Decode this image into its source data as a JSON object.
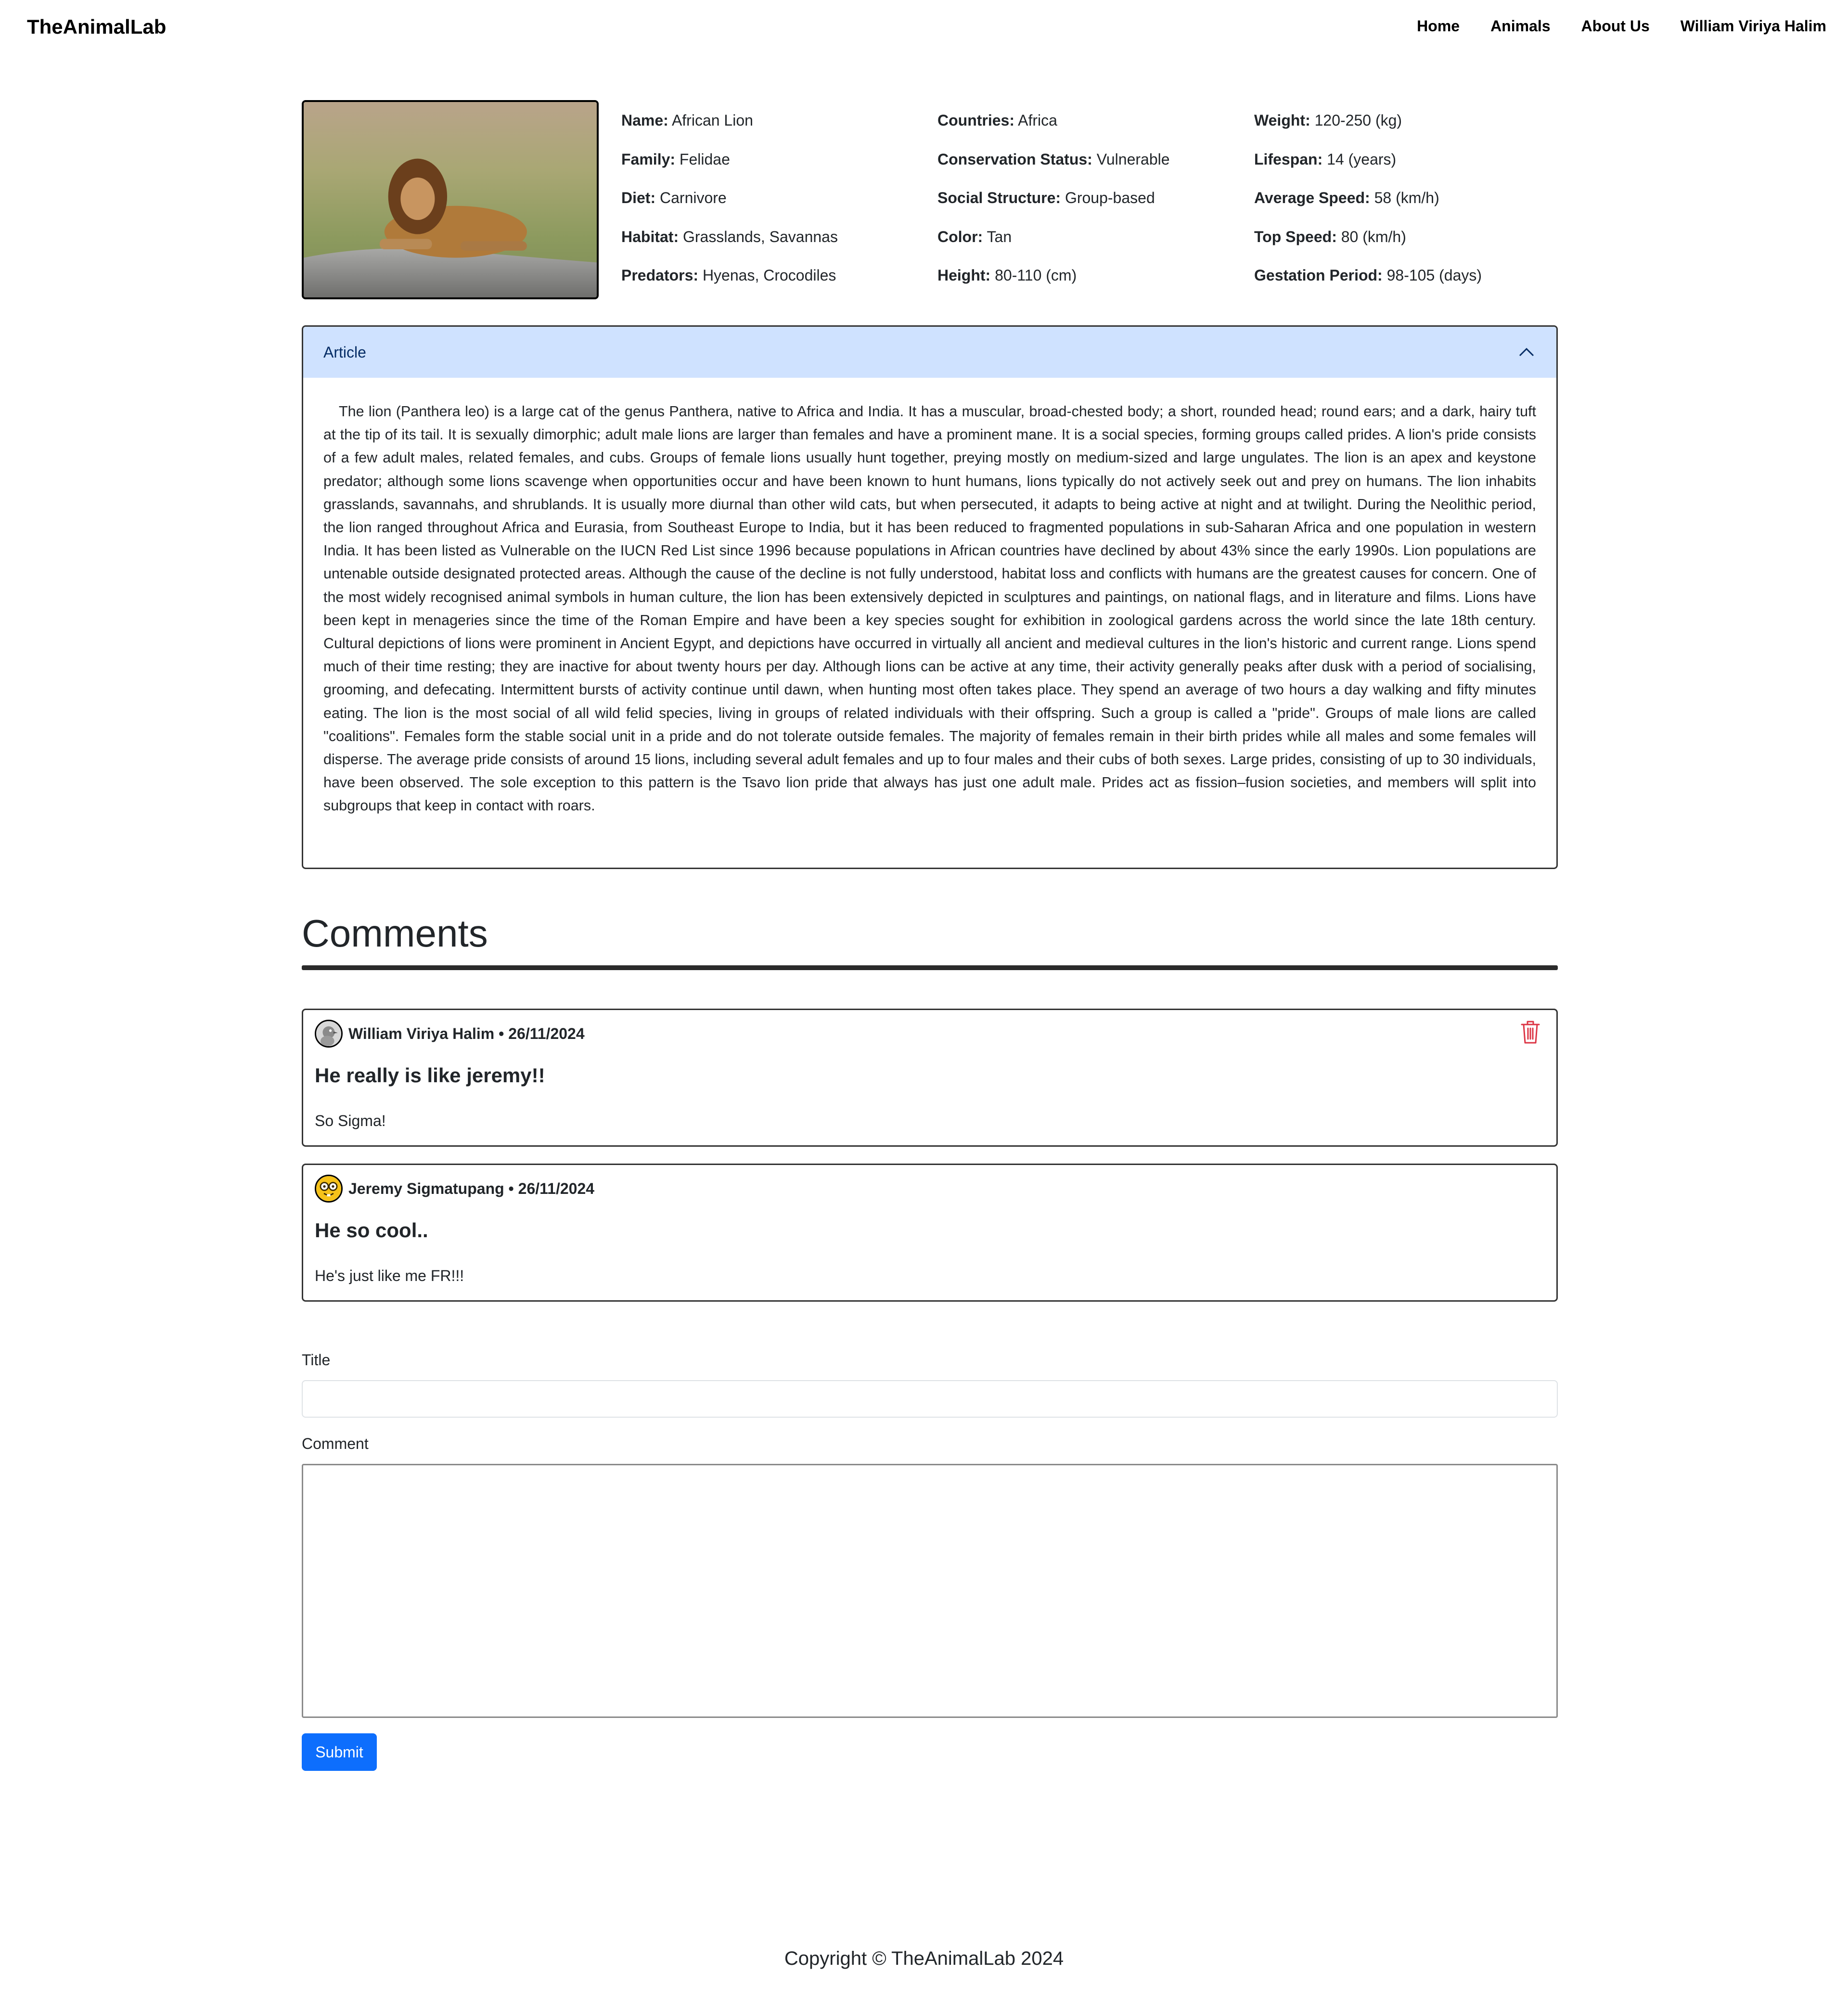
{
  "navbar": {
    "brand": "TheAnimalLab",
    "links": [
      "Home",
      "Animals",
      "About Us",
      "William Viriya Halim"
    ]
  },
  "animal": {
    "image_alt": "African Lion",
    "info": [
      [
        {
          "label": "Name:",
          "value": "African Lion"
        },
        {
          "label": "Family:",
          "value": "Felidae"
        },
        {
          "label": "Diet:",
          "value": "Carnivore"
        },
        {
          "label": "Habitat:",
          "value": "Grasslands, Savannas"
        },
        {
          "label": "Predators:",
          "value": "Hyenas, Crocodiles"
        }
      ],
      [
        {
          "label": "Countries:",
          "value": "Africa"
        },
        {
          "label": "Conservation Status:",
          "value": "Vulnerable"
        },
        {
          "label": "Social Structure:",
          "value": "Group-based"
        },
        {
          "label": "Color:",
          "value": "Tan"
        },
        {
          "label": "Height:",
          "value": "80-110 (cm)"
        }
      ],
      [
        {
          "label": "Weight:",
          "value": "120-250 (kg)"
        },
        {
          "label": "Lifespan:",
          "value": "14 (years)"
        },
        {
          "label": "Average Speed:",
          "value": "58 (km/h)"
        },
        {
          "label": "Top Speed:",
          "value": "80 (km/h)"
        },
        {
          "label": "Gestation Period:",
          "value": "98-105 (days)"
        }
      ]
    ]
  },
  "article": {
    "header": "Article",
    "text": "The lion (Panthera leo) is a large cat of the genus Panthera, native to Africa and India. It has a muscular, broad-chested body; a short, rounded head; round ears; and a dark, hairy tuft at the tip of its tail. It is sexually dimorphic; adult male lions are larger than females and have a prominent mane. It is a social species, forming groups called prides. A lion's pride consists of a few adult males, related females, and cubs. Groups of female lions usually hunt together, preying mostly on medium-sized and large ungulates. The lion is an apex and keystone predator; although some lions scavenge when opportunities occur and have been known to hunt humans, lions typically do not actively seek out and prey on humans. The lion inhabits grasslands, savannahs, and shrublands. It is usually more diurnal than other wild cats, but when persecuted, it adapts to being active at night and at twilight. During the Neolithic period, the lion ranged throughout Africa and Eurasia, from Southeast Europe to India, but it has been reduced to fragmented populations in sub-Saharan Africa and one population in western India. It has been listed as Vulnerable on the IUCN Red List since 1996 because populations in African countries have declined by about 43% since the early 1990s. Lion populations are untenable outside designated protected areas. Although the cause of the decline is not fully understood, habitat loss and conflicts with humans are the greatest causes for concern. One of the most widely recognised animal symbols in human culture, the lion has been extensively depicted in sculptures and paintings, on national flags, and in literature and films. Lions have been kept in menageries since the time of the Roman Empire and have been a key species sought for exhibition in zoological gardens across the world since the late 18th century. Cultural depictions of lions were prominent in Ancient Egypt, and depictions have occurred in virtually all ancient and medieval cultures in the lion's historic and current range. Lions spend much of their time resting; they are inactive for about twenty hours per day. Although lions can be active at any time, their activity generally peaks after dusk with a period of socialising, grooming, and defecating. Intermittent bursts of activity continue until dawn, when hunting most often takes place. They spend an average of two hours a day walking and fifty minutes eating. The lion is the most social of all wild felid species, living in groups of related individuals with their offspring. Such a group is called a \"pride\". Groups of male lions are called \"coalitions\". Females form the stable social unit in a pride and do not tolerate outside females. The majority of females remain in their birth prides while all males and some females will disperse. The average pride consists of around 15 lions, including several adult females and up to four males and their cubs of both sexes. Large prides, consisting of up to 30 individuals, have been observed. The sole exception to this pattern is the Tsavo lion pride that always has just one adult male. Prides act as fission–fusion societies, and members will split into subgroups that keep in contact with roars."
  },
  "comments": {
    "heading": "Comments",
    "items": [
      {
        "author_line": "William Viriya Halim • 26/11/2024",
        "title": "He really is like jeremy!!",
        "body": "So Sigma!",
        "avatar_icon": "bird-avatar",
        "deletable": true
      },
      {
        "author_line": "Jeremy Sigmatupang • 26/11/2024",
        "title": "He so cool..",
        "body": "He's just like me FR!!!",
        "avatar_icon": "nerd-face-avatar",
        "deletable": false
      }
    ]
  },
  "form": {
    "title_label": "Title",
    "title_value": "",
    "comment_label": "Comment",
    "comment_value": "",
    "submit_label": "Submit"
  },
  "footer": {
    "text": "Copyright © TheAnimalLab 2024"
  },
  "colors": {
    "accent": "#0d6efd",
    "article_header_bg": "#cfe2ff",
    "article_header_text": "#052c65",
    "delete_icon": "#dc3545"
  }
}
